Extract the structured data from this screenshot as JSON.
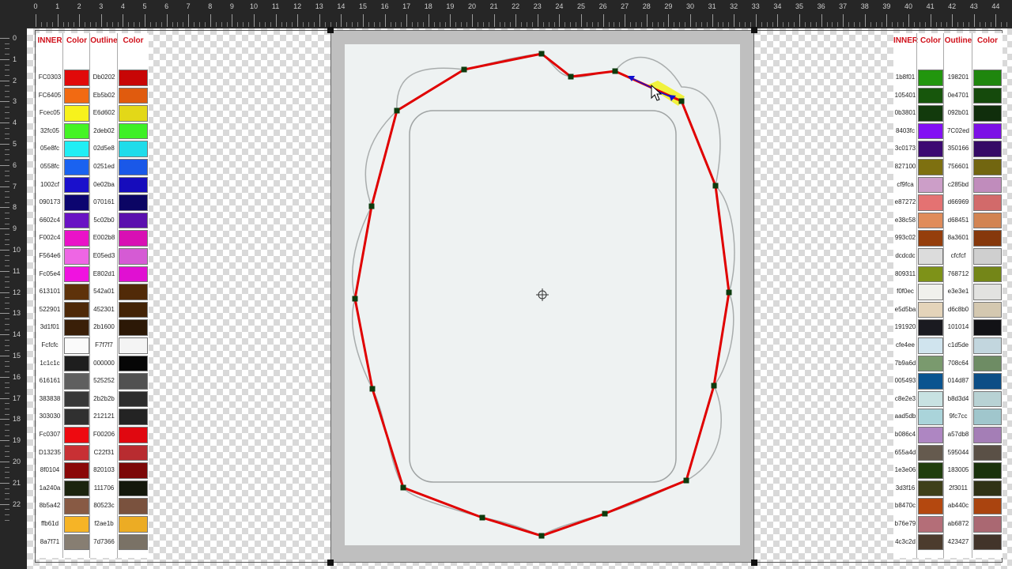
{
  "ruler": {
    "top_numbers": [
      "0",
      "1",
      "2",
      "3",
      "4",
      "5",
      "6",
      "7",
      "8",
      "9",
      "10",
      "11",
      "12",
      "13",
      "14",
      "15",
      "16",
      "17",
      "18",
      "19",
      "20",
      "21",
      "22",
      "23",
      "24",
      "25",
      "26",
      "27",
      "28",
      "29",
      "30",
      "31",
      "32",
      "33",
      "34",
      "35",
      "36",
      "37",
      "38",
      "39",
      "40",
      "41",
      "42",
      "43",
      "44"
    ],
    "left_numbers": [
      "0",
      "1",
      "2",
      "3",
      "4",
      "5",
      "6",
      "7",
      "8",
      "9",
      "10",
      "11",
      "12",
      "13",
      "14",
      "15",
      "16",
      "17",
      "18",
      "19",
      "20",
      "21",
      "22"
    ]
  },
  "palette_left": {
    "headers": [
      "INNER",
      "Color",
      "Outline",
      "Color"
    ],
    "rows": [
      {
        "inner": "FC0303",
        "inner_color": "#e10a0a",
        "outline": "Db0202",
        "outline_color": "#c80606"
      },
      {
        "inner": "FC6405",
        "inner_color": "#f26a12",
        "outline": "Eb5b02",
        "outline_color": "#e05b0e"
      },
      {
        "inner": "Fcec05",
        "inner_color": "#f7f21c",
        "outline": "E6d602",
        "outline_color": "#e3d818"
      },
      {
        "inner": "32fc05",
        "inner_color": "#44f425",
        "outline": "2deb02",
        "outline_color": "#3ef026"
      },
      {
        "inner": "05e8fc",
        "inner_color": "#20eef4",
        "outline": "02d5e8",
        "outline_color": "#1fdcea"
      },
      {
        "inner": "0558fc",
        "inner_color": "#1a62f0",
        "outline": "0251ed",
        "outline_color": "#1a58e8"
      },
      {
        "inner": "1002cf",
        "inner_color": "#1a10cc",
        "outline": "0e02ba",
        "outline_color": "#160cbc"
      },
      {
        "inner": "090173",
        "inner_color": "#0c0570",
        "outline": "070161",
        "outline_color": "#0b0564"
      },
      {
        "inner": "6602c4",
        "inner_color": "#6912c4",
        "outline": "5c02b0",
        "outline_color": "#5b10ae"
      },
      {
        "inner": "F002c4",
        "inner_color": "#ea12c8",
        "outline": "E002b8",
        "outline_color": "#d810b4"
      },
      {
        "inner": "F564e6",
        "inner_color": "#ee66e4",
        "outline": "E05ed3",
        "outline_color": "#d55bd4"
      },
      {
        "inner": "Fc05e4",
        "inner_color": "#f012e0",
        "outline": "E802d1",
        "outline_color": "#e010d2"
      },
      {
        "inner": "613101",
        "inner_color": "#5e320a",
        "outline": "542a01",
        "outline_color": "#512a08"
      },
      {
        "inner": "522901",
        "inner_color": "#4e2908",
        "outline": "452301",
        "outline_color": "#432306"
      },
      {
        "inner": "3d1f01",
        "inner_color": "#3a1f08",
        "outline": "2b1600",
        "outline_color": "#2c1806"
      },
      {
        "inner": "Fcfcfc",
        "inner_color": "#fafafa",
        "outline": "F7f7f7",
        "outline_color": "#f4f4f4"
      },
      {
        "inner": "1c1c1c",
        "inner_color": "#1e1e1e",
        "outline": "000000",
        "outline_color": "#060606"
      },
      {
        "inner": "616161",
        "inner_color": "#5f5f5f",
        "outline": "525252",
        "outline_color": "#515151"
      },
      {
        "inner": "383838",
        "inner_color": "#383838",
        "outline": "2b2b2b",
        "outline_color": "#2c2c2c"
      },
      {
        "inner": "303030",
        "inner_color": "#303030",
        "outline": "212121",
        "outline_color": "#232323"
      },
      {
        "inner": "Fc0307",
        "inner_color": "#ee0a10",
        "outline": "F00206",
        "outline_color": "#e00810"
      },
      {
        "inner": "D13235",
        "inner_color": "#c83034",
        "outline": "C22f31",
        "outline_color": "#b82c30"
      },
      {
        "inner": "8f0104",
        "inner_color": "#8a0808",
        "outline": "820103",
        "outline_color": "#7c0808"
      },
      {
        "inner": "1a240a",
        "inner_color": "#1c240e",
        "outline": "111706",
        "outline_color": "#14180c"
      },
      {
        "inner": "8b5a42",
        "inner_color": "#885a44",
        "outline": "80523c",
        "outline_color": "#7a523e"
      },
      {
        "inner": "ffb61d",
        "inner_color": "#f6b426",
        "outline": "f2ae1b",
        "outline_color": "#ecac24"
      },
      {
        "inner": "8a7f71",
        "inner_color": "#877e72",
        "outline": "7d7366",
        "outline_color": "#7a7266"
      }
    ]
  },
  "palette_right": {
    "headers": [
      "INNER",
      "Color",
      "Outline",
      "Color"
    ],
    "rows": [
      {
        "inner": "1b8f01",
        "inner_color": "#22960e",
        "outline": "198201",
        "outline_color": "#1f860e"
      },
      {
        "inner": "105401",
        "inner_color": "#17560c",
        "outline": "0e4701",
        "outline_color": "#154a0c"
      },
      {
        "inner": "0b3801",
        "inner_color": "#123a0c",
        "outline": "092b01",
        "outline_color": "#102e0c"
      },
      {
        "inner": "8403fc",
        "inner_color": "#8210f4",
        "outline": "7C02ed",
        "outline_color": "#7c10e6"
      },
      {
        "inner": "3c0173",
        "inner_color": "#3c0a72",
        "outline": "350166",
        "outline_color": "#350a66"
      },
      {
        "inner": "827100",
        "inner_color": "#7e7010",
        "outline": "756601",
        "outline_color": "#726610"
      },
      {
        "inner": "cf9fca",
        "inner_color": "#cc9ec8",
        "outline": "c285bd",
        "outline_color": "#c08cbc"
      },
      {
        "inner": "e87272",
        "inner_color": "#e47272",
        "outline": "d66969",
        "outline_color": "#d26a6a"
      },
      {
        "inner": "e38c58",
        "inner_color": "#e08c5a",
        "outline": "d68451",
        "outline_color": "#d28452"
      },
      {
        "inner": "993c02",
        "inner_color": "#953e0c",
        "outline": "8a3601",
        "outline_color": "#86380c"
      },
      {
        "inner": "dcdcdc",
        "inner_color": "#dcdcdc",
        "outline": "cfcfcf",
        "outline_color": "#cfcfcf"
      },
      {
        "inner": "809311",
        "inner_color": "#7e9218",
        "outline": "768712",
        "outline_color": "#748618"
      },
      {
        "inner": "f0f0ec",
        "inner_color": "#f0f0ec",
        "outline": "e3e3e1",
        "outline_color": "#e2e2e0"
      },
      {
        "inner": "e5d5ba",
        "inner_color": "#e4d4ba",
        "outline": "d6c8b0",
        "outline_color": "#d4c8b0"
      },
      {
        "inner": "191920",
        "inner_color": "#1a1a20",
        "outline": "101014",
        "outline_color": "#121216"
      },
      {
        "inner": "cfe4ee",
        "inner_color": "#d0e4ee",
        "outline": "c1d5de",
        "outline_color": "#c2d6de"
      },
      {
        "inner": "7b9a6d",
        "inner_color": "#7a9a6e",
        "outline": "708c64",
        "outline_color": "#6e8c64"
      },
      {
        "inner": "005493",
        "inner_color": "#0a5490",
        "outline": "014d87",
        "outline_color": "#0c4e86"
      },
      {
        "inner": "c8e2e3",
        "inner_color": "#c8e2e2",
        "outline": "b8d3d4",
        "outline_color": "#b8d2d4"
      },
      {
        "inner": "aad5db",
        "inner_color": "#aad4da",
        "outline": "9fc7cc",
        "outline_color": "#a0c6cc"
      },
      {
        "inner": "b086c4",
        "inner_color": "#ae86c2",
        "outline": "a57db8",
        "outline_color": "#a47eb6"
      },
      {
        "inner": "655a4d",
        "inner_color": "#655a4e",
        "outline": "595044",
        "outline_color": "#5a5046"
      },
      {
        "inner": "1e3e06",
        "inner_color": "#203e0e",
        "outline": "183005",
        "outline_color": "#1a320c"
      },
      {
        "inner": "3d3f16",
        "inner_color": "#3e401a",
        "outline": "2f3011",
        "outline_color": "#303216"
      },
      {
        "inner": "b8470c",
        "inner_color": "#b4480f",
        "outline": "ab440c",
        "outline_color": "#aa440f"
      },
      {
        "inner": "b76e79",
        "inner_color": "#b46e78",
        "outline": "ab6872",
        "outline_color": "#aa6872"
      },
      {
        "inner": "4c3c2d",
        "inner_color": "#4c3c2e",
        "outline": "423427",
        "outline_color": "#42342a"
      }
    ]
  },
  "colors": {
    "app_background": "#2b2b2b",
    "ruler_background": "#262626",
    "stroke_red": "#e00000",
    "node_fill": "#0d3b0d",
    "selection_highlight": "#f2f200",
    "direction_arrow": "#1010d0",
    "sketch_line": "#a9adad",
    "document_paper": "#eef2f2"
  },
  "icons": [
    "mouse-pointer-icon",
    "center-crosshair-icon",
    "direction-arrow-icon"
  ]
}
